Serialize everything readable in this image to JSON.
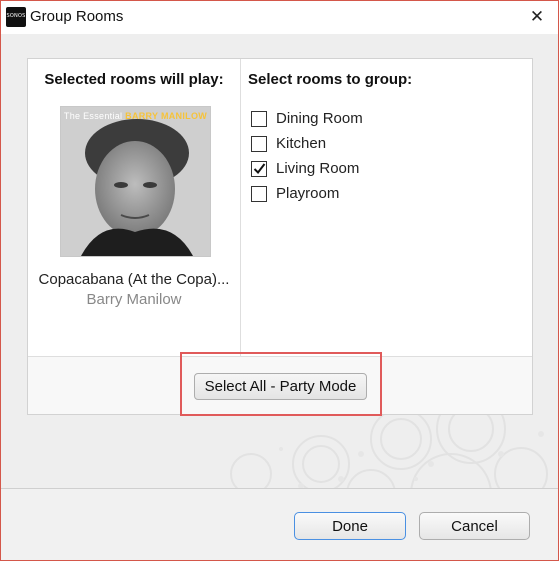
{
  "window": {
    "title": "Group Rooms",
    "app_icon_text": "SONOS",
    "close_glyph": "✕"
  },
  "left_panel": {
    "heading": "Selected rooms will play:",
    "album": {
      "cover_prefix": "The Essential ",
      "cover_artist": "BARRY MANILOW"
    },
    "song_title": "Copacabana (At the Copa)...",
    "artist": "Barry Manilow"
  },
  "right_panel": {
    "heading": "Select rooms to group:",
    "rooms": [
      {
        "label": "Dining Room",
        "checked": false
      },
      {
        "label": "Kitchen",
        "checked": false
      },
      {
        "label": "Living Room",
        "checked": true
      },
      {
        "label": "Playroom",
        "checked": false
      }
    ]
  },
  "party_mode_button": "Select All - Party Mode",
  "footer": {
    "done_label": "Done",
    "cancel_label": "Cancel"
  },
  "colors": {
    "highlight": "#e05a5a",
    "window_border": "#d4574a",
    "default_button_border": "#4a90e2"
  }
}
